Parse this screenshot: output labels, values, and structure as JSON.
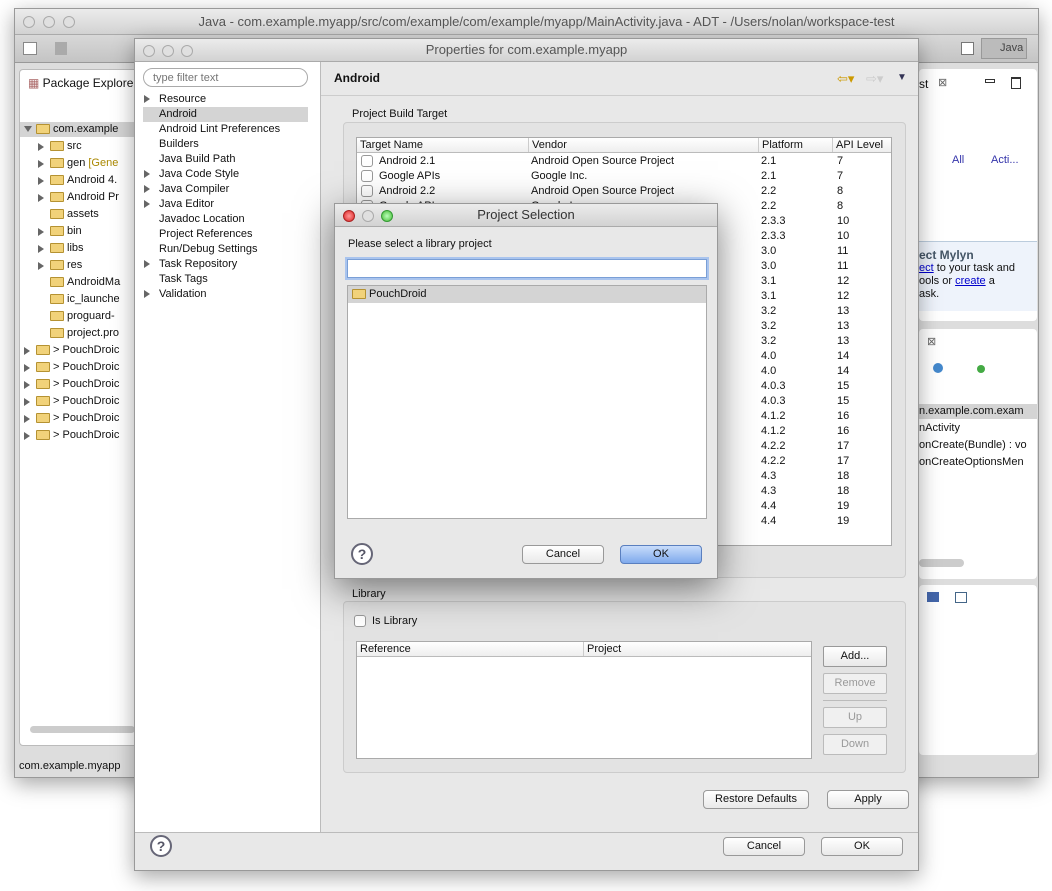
{
  "main_window": {
    "title": "Java - com.example.myapp/src/com/example/com/example/myapp/MainActivity.java - ADT - /Users/nolan/workspace-test",
    "perspective": "Java",
    "status": "com.example.myapp"
  },
  "package_explorer": {
    "title": "Package Explore",
    "items": [
      {
        "label": "com.example",
        "indent": 0,
        "expanded": true,
        "selected": true
      },
      {
        "label": "src",
        "indent": 1,
        "arrow": true
      },
      {
        "label": "gen",
        "suffix": "[Gene",
        "indent": 1,
        "arrow": true
      },
      {
        "label": "Android 4.",
        "indent": 1,
        "arrow": true
      },
      {
        "label": "Android Pr",
        "indent": 1,
        "arrow": true
      },
      {
        "label": "assets",
        "indent": 1
      },
      {
        "label": "bin",
        "indent": 1,
        "arrow": true
      },
      {
        "label": "libs",
        "indent": 1,
        "arrow": true
      },
      {
        "label": "res",
        "indent": 1,
        "arrow": true
      },
      {
        "label": "AndroidMa",
        "indent": 1
      },
      {
        "label": "ic_launche",
        "indent": 1
      },
      {
        "label": "proguard-",
        "indent": 1
      },
      {
        "label": "project.pro",
        "indent": 1
      },
      {
        "label": "> PouchDroic",
        "indent": 0,
        "arrow": true
      },
      {
        "label": "> PouchDroic",
        "indent": 0,
        "arrow": true
      },
      {
        "label": "> PouchDroic",
        "indent": 0,
        "arrow": true
      },
      {
        "label": "> PouchDroic",
        "indent": 0,
        "arrow": true
      },
      {
        "label": "> PouchDroic",
        "indent": 0,
        "arrow": true
      },
      {
        "label": "> PouchDroic",
        "indent": 0,
        "arrow": true
      }
    ]
  },
  "right_panels": {
    "tasklist_tab": "st",
    "filter_all": "All",
    "filter_acti": "Acti...",
    "mylyn_title": "ect Mylyn",
    "mylyn_link1": "ect",
    "mylyn_text1": " to your task and",
    "mylyn_text2": "ools or ",
    "mylyn_link2": "create",
    "mylyn_text3": " a",
    "mylyn_text4": "ask.",
    "outline": [
      "n.example.com.exam",
      "nActivity",
      "onCreate(Bundle) : vo",
      "onCreateOptionsMen"
    ]
  },
  "properties": {
    "title": "Properties for com.example.myapp",
    "filter_placeholder": "type filter text",
    "page_title": "Android",
    "tree": [
      {
        "label": "Resource",
        "arrow": true
      },
      {
        "label": "Android",
        "selected": true
      },
      {
        "label": "Android Lint Preferences"
      },
      {
        "label": "Builders"
      },
      {
        "label": "Java Build Path"
      },
      {
        "label": "Java Code Style",
        "arrow": true
      },
      {
        "label": "Java Compiler",
        "arrow": true
      },
      {
        "label": "Java Editor",
        "arrow": true
      },
      {
        "label": "Javadoc Location"
      },
      {
        "label": "Project References"
      },
      {
        "label": "Run/Debug Settings"
      },
      {
        "label": "Task Repository",
        "arrow": true
      },
      {
        "label": "Task Tags"
      },
      {
        "label": "Validation",
        "arrow": true
      }
    ],
    "build_target": {
      "label": "Project Build Target",
      "columns": [
        "Target Name",
        "Vendor",
        "Platform",
        "API Level"
      ],
      "rows": [
        [
          "Android 2.1",
          "Android Open Source Project",
          "2.1",
          "7"
        ],
        [
          "Google APIs",
          "Google Inc.",
          "2.1",
          "7"
        ],
        [
          "Android 2.2",
          "Android Open Source Project",
          "2.2",
          "8"
        ],
        [
          "Google APIs",
          "Google Inc.",
          "2.2",
          "8"
        ],
        [
          "",
          "",
          "2.3.3",
          "10"
        ],
        [
          "",
          "",
          "2.3.3",
          "10"
        ],
        [
          "",
          "",
          "3.0",
          "11"
        ],
        [
          "",
          "",
          "3.0",
          "11"
        ],
        [
          "",
          "",
          "3.1",
          "12"
        ],
        [
          "",
          "",
          "3.1",
          "12"
        ],
        [
          "",
          "",
          "3.2",
          "13"
        ],
        [
          "",
          "",
          "3.2",
          "13"
        ],
        [
          "",
          "",
          "3.2",
          "13"
        ],
        [
          "",
          "",
          "4.0",
          "14"
        ],
        [
          "",
          "",
          "4.0",
          "14"
        ],
        [
          "",
          "",
          "4.0.3",
          "15"
        ],
        [
          "",
          "",
          "4.0.3",
          "15"
        ],
        [
          "",
          "",
          "4.1.2",
          "16"
        ],
        [
          "",
          "",
          "4.1.2",
          "16"
        ],
        [
          "",
          "",
          "4.2.2",
          "17"
        ],
        [
          "",
          "",
          "4.2.2",
          "17"
        ],
        [
          "",
          "",
          "4.3",
          "18"
        ],
        [
          "",
          "",
          "4.3",
          "18"
        ],
        [
          "",
          "",
          "4.4",
          "19"
        ],
        [
          "",
          "",
          "4.4",
          "19"
        ]
      ]
    },
    "library": {
      "label": "Library",
      "is_library_label": "Is Library",
      "is_library": false,
      "columns": [
        "Reference",
        "Project"
      ],
      "add": "Add...",
      "remove": "Remove",
      "up": "Up",
      "down": "Down"
    },
    "restore_defaults": "Restore Defaults",
    "apply": "Apply",
    "cancel": "Cancel",
    "ok": "OK"
  },
  "project_selection": {
    "title": "Project Selection",
    "prompt": "Please select a library project",
    "filter_value": "",
    "items": [
      {
        "label": "PouchDroid",
        "selected": true
      }
    ],
    "cancel": "Cancel",
    "ok": "OK"
  }
}
